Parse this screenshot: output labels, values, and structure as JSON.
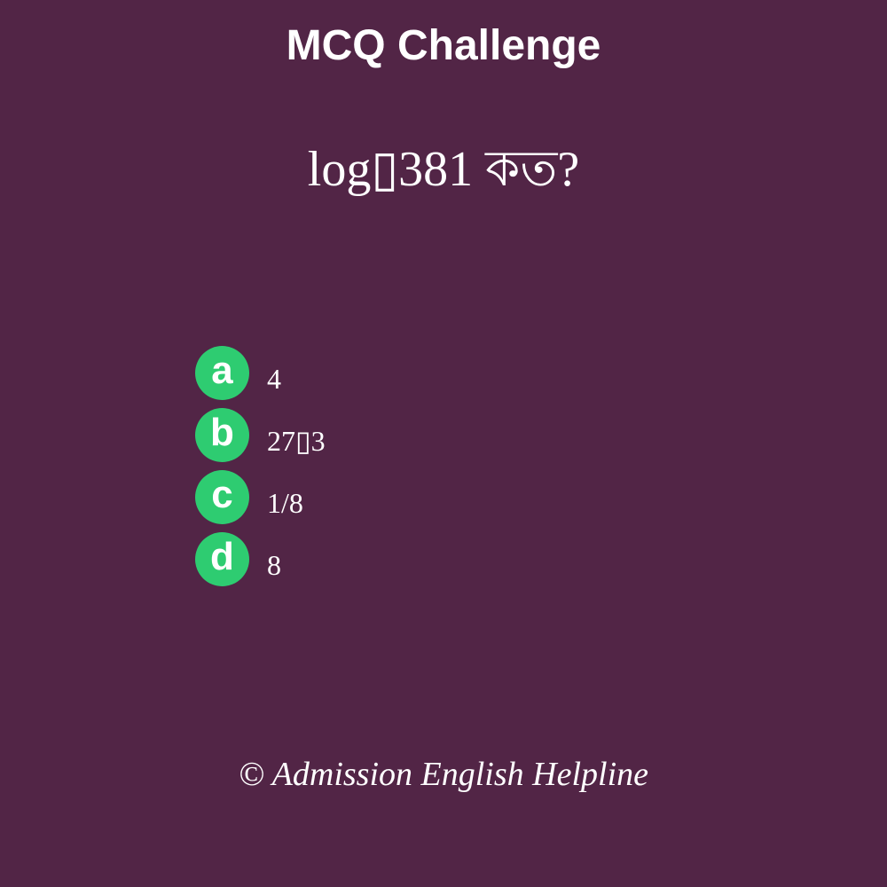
{
  "header": {
    "title": "MCQ Challenge"
  },
  "question": {
    "text": "log▯381 কত?"
  },
  "options": [
    {
      "letter": "a",
      "text": "4"
    },
    {
      "letter": "b",
      "text": "27▯3"
    },
    {
      "letter": "c",
      "text": "1/8"
    },
    {
      "letter": "d",
      "text": "8"
    }
  ],
  "footer": {
    "text": "© Admission English Helpline"
  },
  "colors": {
    "background": "#522546",
    "badge": "#2ecc71",
    "text": "#ffffff"
  }
}
